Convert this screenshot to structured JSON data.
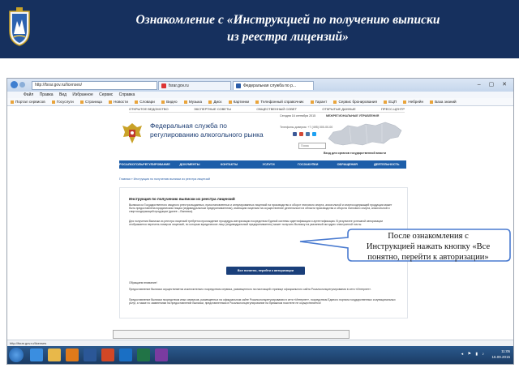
{
  "slide": {
    "title_line1": "Ознакомление с «Инструкцией по получению выписки",
    "title_line2": "из реестра лицензий»",
    "header_color": "#16305e"
  },
  "browser": {
    "address": "http://fsrar.gov.ru/licenses/",
    "tab1": "fsrar.gov.ru",
    "tab2": "Федеральная служба по р...",
    "window_controls": "– ▢ ✕",
    "menu": [
      "Файл",
      "Правка",
      "Вид",
      "Избранное",
      "Сервис",
      "Справка"
    ],
    "favorites": [
      "Портал сервисов",
      "Госуслуги",
      "Страница",
      "Новости",
      "Словари",
      "Видео",
      "Музыка",
      "Диск",
      "Картинки",
      "Телефонный справочник",
      "Гарант",
      "Сервис бронирования",
      "ЕЦП",
      "Небрейн",
      "База знаний"
    ],
    "status_url": "http://fsrar.gov.ru/licenses"
  },
  "site": {
    "topnav": [
      "ОТКРЫТОЕ ВЕДОМСТВО",
      "ЭКСПЕРТНЫЕ СОВЕТЫ",
      "ОБЩЕСТВЕННЫЙ СОВЕТ",
      "ОТКРЫТЫЕ ДАННЫЕ",
      "ПРЕСС-ЦЕНТР"
    ],
    "title": "Федеральная служба по регулированию алкогольного рынка",
    "date": "Сегодня 16 сентября 2015",
    "portal": "МЕЖРЕГИОНАЛЬНЫЕ УПРАВЛЕНИЯ",
    "phones": "Телефоны доверия: +7 (495) 000-00-00",
    "search_placeholder": "Поиск",
    "reg_link": "Вход для органов государственной власти",
    "mainnav": [
      "РОСАЛКОГОЛЬРЕГУЛИРОВАНИЕ",
      "ДОКУМЕНТЫ",
      "КОНТАКТЫ",
      "УСЛУГИ",
      "ГОСЗАКУПКИ",
      "ОБРАЩЕНИЯ",
      "ДЕЯТЕЛЬНОСТЬ"
    ],
    "breadcrumb": "Главная » Инструкция по получению выписки из реестра лицензий",
    "doc_title": "Инструкция по получению выписки из реестра лицензий",
    "para1": "Выписка из Государственного сводного реестра выданных, приостановленных и аннулированных лицензий на производство и оборот этилового спирта, алкогольной и спиртосодержащей продукции может быть предоставлена юридическим лицам (индивидуальным предпринимателям), имеющим лицензии на осуществление деятельности в области производства и оборота этилового спирта, алкогольной и спиртосодержащей продукции (далее – Выписка).",
    "para2": "Для получения Выписки из реестра лицензий требуется прохождение процедуры авторизации посредством Единой системы идентификации и аутентификации. В результате успешной авторизации отображается перечень номеров лицензий, по которым юридическое лицо (индивидуальный предприниматель) может получить Выписку на указанный им адрес электронной почты.",
    "button_label": "Все понятно, перейти к авторизации",
    "para3": "Обращаем внимание!",
    "para4": "Предоставление Выписки осуществляется исключительно посредством сервиса, размещенного на настоящей странице официального сайта Росалкогольрегулирования в сети «Интернет».",
    "para5": "Предоставление Выписки посредством иных сервисов, размещенных на официальном сайте Росалкогольрегулирования в сети «Интернет», посредством Единого портала государственных и муниципальных услуг, а также по заявлениям на предоставление Выписки, представленным в Росалкогольрегулирование на бумажном носителе не осуществляется!"
  },
  "taskbar": {
    "time": "11:05",
    "date": "16.09.2015",
    "tray_icons": "◂ ⚑ ▮ ♪"
  },
  "callout": {
    "line1": "После ознакомления с",
    "line2": "Инструкцией  нажать кнопку «Все",
    "line3": "понятно, перейти к авторизации»"
  }
}
